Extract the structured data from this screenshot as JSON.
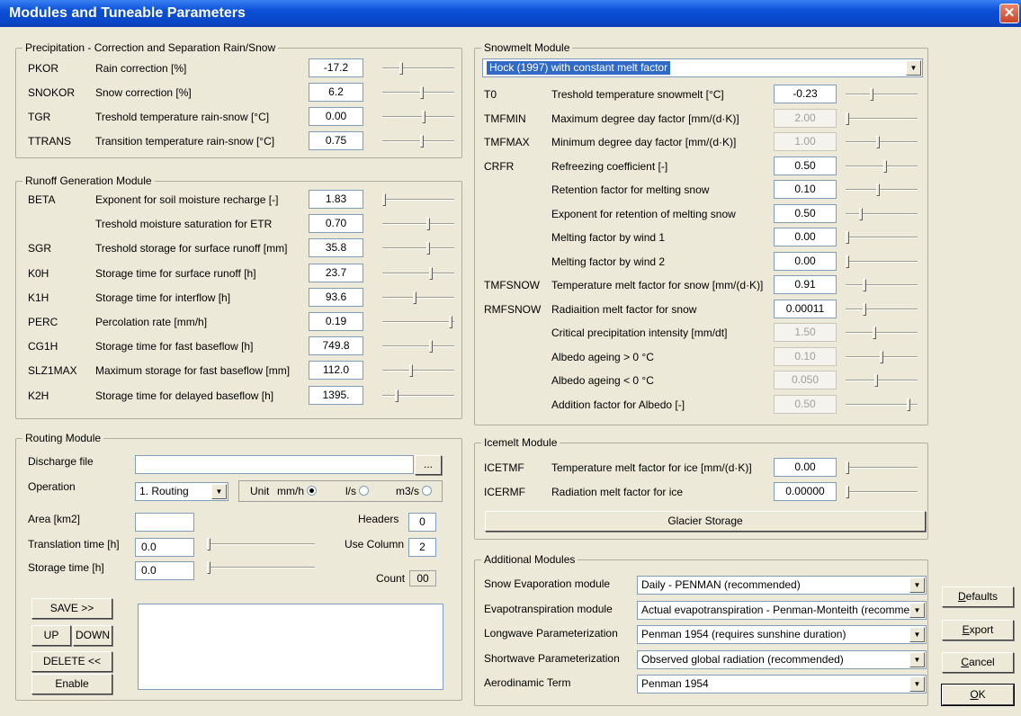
{
  "window": {
    "title": "Modules and Tuneable Parameters",
    "close_glyph": "✕"
  },
  "precip": {
    "title": "Precipitation - Correction and Separation Rain/Snow",
    "rows": [
      {
        "code": "PKOR",
        "desc": "Rain correction [%]",
        "value": "-17.2",
        "slider": 0.25
      },
      {
        "code": "SNOKOR",
        "desc": "Snow correction [%]",
        "value": "6.2",
        "slider": 0.55
      },
      {
        "code": "TGR",
        "desc": "Treshold temperature rain-snow [°C]",
        "value": "0.00",
        "slider": 0.58
      },
      {
        "code": "TTRANS",
        "desc": "Transition temperature rain-snow [°C]",
        "value": "0.75",
        "slider": 0.55
      }
    ]
  },
  "runoff": {
    "title": "Runoff Generation Module",
    "rows": [
      {
        "code": "BETA",
        "desc": "Exponent for soil moisture recharge [-]",
        "value": "1.83",
        "slider": 0.0
      },
      {
        "code": "",
        "desc": "Treshold moisture saturation for ETR",
        "value": "0.70",
        "slider": 0.65
      },
      {
        "code": "SGR",
        "desc": "Treshold storage for surface runoff [mm]",
        "value": "35.8",
        "slider": 0.65
      },
      {
        "code": "K0H",
        "desc": "Storage time for surface runoff [h]",
        "value": "23.7",
        "slider": 0.68
      },
      {
        "code": "K1H",
        "desc": "Storage time for interflow [h]",
        "value": "93.6",
        "slider": 0.45
      },
      {
        "code": "PERC",
        "desc": "Percolation rate [mm/h]",
        "value": "0.19",
        "slider": 0.98
      },
      {
        "code": "CG1H",
        "desc": "Storage time for fast baseflow [h]",
        "value": "749.8",
        "slider": 0.68
      },
      {
        "code": "SLZ1MAX",
        "desc": "Maximum storage for fast baseflow [mm]",
        "value": "112.0",
        "slider": 0.4
      },
      {
        "code": "K2H",
        "desc": "Storage time for delayed baseflow [h]",
        "value": "1395.",
        "slider": 0.18
      }
    ]
  },
  "routing": {
    "title": "Routing Module",
    "discharge_label": "Discharge file",
    "discharge_value": "",
    "browse_label": "...",
    "operation_label": "Operation",
    "operation_value": "1. Routing",
    "unit_label": "Unit",
    "units": [
      "mm/h",
      "l/s",
      "m3/s"
    ],
    "unit_selected": "mm/h",
    "area_label": "Area [km2]",
    "area_value": "",
    "headers_label": "Headers",
    "headers_value": "0",
    "translation_label": "Translation time [h]",
    "translation_value": "0.0",
    "use_column_label": "Use Column",
    "use_column_value": "2",
    "storage_label": "Storage time [h]",
    "storage_value": "0.0",
    "count_label": "Count",
    "count_value": "00",
    "buttons": {
      "save": "SAVE >>",
      "up": "UP",
      "down": "DOWN",
      "delete": "DELETE <<",
      "enable": "Enable"
    }
  },
  "snowmelt": {
    "title": "Snowmelt Module",
    "method": "Hock (1997)  with constant melt factor",
    "rows": [
      {
        "code": "T0",
        "desc": "Treshold temperature snowmelt [°C]",
        "value": "-0.23",
        "slider": 0.35,
        "disabled": false
      },
      {
        "code": "TMFMIN",
        "desc": "Maximum degree day factor [mm/(d·K)]",
        "value": "2.00",
        "slider": 0.0,
        "disabled": true
      },
      {
        "code": "TMFMAX",
        "desc": "Minimum degree day factor [mm/(d·K)]",
        "value": "1.00",
        "slider": 0.45,
        "disabled": true
      },
      {
        "code": "CRFR",
        "desc": "Refreezing coefficient [-]",
        "value": "0.50",
        "slider": 0.55,
        "disabled": false
      },
      {
        "code": "",
        "desc": "Retention factor for melting snow",
        "value": "0.10",
        "slider": 0.45,
        "disabled": false
      },
      {
        "code": "",
        "desc": "Exponent for retention of melting snow",
        "value": "0.50",
        "slider": 0.2,
        "disabled": false
      },
      {
        "code": "",
        "desc": "Melting factor by wind 1",
        "value": "0.00",
        "slider": 0.0,
        "disabled": false
      },
      {
        "code": "",
        "desc": "Melting factor by wind 2",
        "value": "0.00",
        "slider": 0.0,
        "disabled": false
      },
      {
        "code": "TMFSNOW",
        "desc": "Temperature melt factor for snow [mm/(d·K)]",
        "value": "0.91",
        "slider": 0.25,
        "disabled": false
      },
      {
        "code": "RMFSNOW",
        "desc": "Radiaition melt factor for snow",
        "value": "0.00011",
        "slider": 0.25,
        "disabled": false
      },
      {
        "code": "",
        "desc": "Critical precipitation intensity [mm/dt]",
        "value": "1.50",
        "slider": 0.4,
        "disabled": true
      },
      {
        "code": "",
        "desc": "Albedo ageing > 0 °C",
        "value": "0.10",
        "slider": 0.5,
        "disabled": true
      },
      {
        "code": "",
        "desc": "Albedo ageing < 0 °C",
        "value": "0.050",
        "slider": 0.42,
        "disabled": true
      },
      {
        "code": "",
        "desc": "Addition factor for Albedo [-]",
        "value": "0.50",
        "slider": 0.9,
        "disabled": true
      }
    ]
  },
  "icemelt": {
    "title": "Icemelt Module",
    "rows": [
      {
        "code": "ICETMF",
        "desc": "Temperature melt factor for ice [mm/(d·K)]",
        "value": "0.00",
        "slider": 0.0
      },
      {
        "code": "ICERMF",
        "desc": "Radiation melt factor for ice",
        "value": "0.00000",
        "slider": 0.0
      }
    ],
    "glacier_button": "Glacier Storage"
  },
  "additional": {
    "title": "Additional Modules",
    "rows": [
      {
        "label": "Snow Evaporation module",
        "value": "Daily - PENMAN (recommended)"
      },
      {
        "label": "Evapotranspiration module",
        "value": "Actual evapotranspiration - Penman-Monteith (recomme"
      },
      {
        "label": "Longwave Parameterization",
        "value": "Penman 1954 (requires sunshine duration)"
      },
      {
        "label": "Shortwave Parameterization",
        "value": "Observed global radiation (recommended)"
      },
      {
        "label": "Aerodinamic Term",
        "value": "Penman 1954"
      }
    ]
  },
  "dialog_buttons": {
    "defaults": {
      "text": "Defaults",
      "key": "D"
    },
    "export": {
      "text": "Export",
      "key": "E"
    },
    "cancel": {
      "text": "Cancel",
      "key": "C"
    },
    "ok": {
      "text": "OK",
      "key": "O"
    }
  }
}
